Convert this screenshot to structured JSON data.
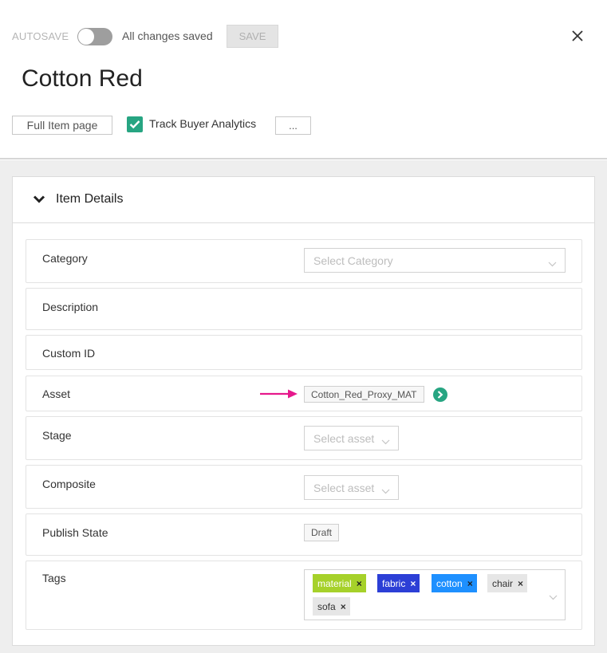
{
  "header": {
    "autosave_label": "AUTOSAVE",
    "autosave_on": false,
    "save_status": "All changes saved",
    "save_label": "SAVE",
    "title": "Cotton Red",
    "full_item_label": "Full Item page",
    "track_label": "Track Buyer Analytics",
    "track_checked": true,
    "more_label": "..."
  },
  "panel": {
    "title": "Item Details",
    "fields": {
      "category": {
        "label": "Category",
        "placeholder": "Select Category"
      },
      "description": {
        "label": "Description"
      },
      "custom_id": {
        "label": "Custom ID"
      },
      "asset": {
        "label": "Asset",
        "value": "Cotton_Red_Proxy_MAT"
      },
      "stage": {
        "label": "Stage",
        "placeholder": "Select asset"
      },
      "composite": {
        "label": "Composite",
        "placeholder": "Select asset"
      },
      "publish_state": {
        "label": "Publish State",
        "value": "Draft"
      },
      "tags": {
        "label": "Tags",
        "items": [
          {
            "text": "material",
            "bg": "#a6d12a",
            "fg": "#ffffff",
            "x_color": "#222222"
          },
          {
            "text": "fabric",
            "bg": "#2c3fd6",
            "fg": "#ffffff",
            "x_color": "#ffffff"
          },
          {
            "text": "cotton",
            "bg": "#1e90ff",
            "fg": "#ffffff",
            "x_color": "#222222"
          },
          {
            "text": "chair",
            "bg": "#e6e6e6",
            "fg": "#333333",
            "x_color": "#333333"
          },
          {
            "text": "sofa",
            "bg": "#e6e6e6",
            "fg": "#333333",
            "x_color": "#333333"
          }
        ],
        "remove_glyph": "×"
      }
    }
  },
  "colors": {
    "accent_green": "#27a582",
    "annotation_arrow": "#e6198c"
  }
}
